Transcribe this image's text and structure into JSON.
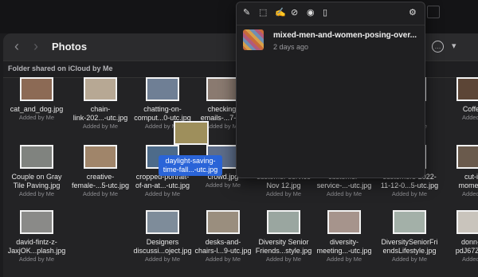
{
  "window": {
    "title": "Photos"
  },
  "share_bar": {
    "text": "Folder shared on iCloud by Me"
  },
  "files": [
    {
      "name_lines": [
        "cat_and_dog.jpg"
      ],
      "added": "Added by Me",
      "color": "#8c6a55"
    },
    {
      "name_lines": [
        "chain-",
        "link-202...-utc.jpg"
      ],
      "added": "Added by Me",
      "color": "#b7a894"
    },
    {
      "name_lines": [
        "chatting-on-",
        "comput...0-utc.jpg"
      ],
      "added": "Added by Me",
      "color": "#6f7f95"
    },
    {
      "name_lines": [
        "checking-",
        "emails-...7-utc"
      ],
      "added": "Added by Me",
      "color": "#8a7a70"
    },
    {
      "name_lines": [
        ""
      ],
      "added": "",
      "color": "#2a2a2c"
    },
    {
      "name_lines": [
        ""
      ],
      "added": "",
      "color": "#2a2a2c"
    },
    {
      "name_lines": [
        "ice",
        "...-utc.jpg"
      ],
      "added": "Added by Me",
      "color": "#7b8a93"
    },
    {
      "name_lines": [
        "Coffee"
      ],
      "added": "Added b",
      "color": "#5c4536"
    },
    {
      "name_lines": [
        "Couple on Gray",
        "Tile Paving.jpg"
      ],
      "added": "Added by Me",
      "color": "#80837f"
    },
    {
      "name_lines": [
        "creative-",
        "female-...5-utc.jpg"
      ],
      "added": "Added by Me",
      "color": "#a0856a"
    },
    {
      "name_lines": [
        "cropped-portrait-",
        "of-an-at...-utc.jpg"
      ],
      "added": "Added by Me",
      "color": "#4d6b8a"
    },
    {
      "name_lines": [
        "crowd.jpg"
      ],
      "added": "Added by Me",
      "color": "#5d6d8a"
    },
    {
      "name_lines": [
        "customer service",
        "Nov 12.jpg"
      ],
      "added": "Added by Me",
      "color": "#3f6fb0"
    },
    {
      "name_lines": [
        "customer-",
        "service-...-utc.jpg"
      ],
      "added": "Added by Me",
      "color": "#4a7fbd"
    },
    {
      "name_lines": [
        "customers-2022-",
        "11-12-0...5-utc.jpg"
      ],
      "added": "Added by Me",
      "color": "#3b88c4"
    },
    {
      "name_lines": [
        "cut-in",
        "moment.j"
      ],
      "added": "Added b",
      "color": "#6a5a4c"
    },
    {
      "name_lines": [
        "david-fintz-z-",
        "JaxjOK...plash.jpg"
      ],
      "added": "Added by Me",
      "color": "#8a8a88"
    },
    {
      "name_lines": [
        ""
      ],
      "added": "",
      "color": "#2a2a2c"
    },
    {
      "name_lines": [
        "Designers",
        "discussi...oject.jpg"
      ],
      "added": "Added by Me",
      "color": "#7e8c9a"
    },
    {
      "name_lines": [
        "desks-and-",
        "chairs-l...9-utc.jpg"
      ],
      "added": "Added by Me",
      "color": "#9a8e7e"
    },
    {
      "name_lines": [
        "Diversity Senior",
        "Friends...style.jpg"
      ],
      "added": "Added by Me",
      "color": "#9aa6a0"
    },
    {
      "name_lines": [
        "diversity-",
        "meeting...-utc.jpg"
      ],
      "added": "Added by Me",
      "color": "#a6948c"
    },
    {
      "name_lines": [
        "DiversitySeniorFri",
        "endsLifestyle.jpg"
      ],
      "added": "Added by Me",
      "color": "#a3b0a8"
    },
    {
      "name_lines": [
        "donn-st",
        "pdJ67Z...pl"
      ],
      "added": "Added b",
      "color": "#c9c4bc"
    }
  ],
  "drag": {
    "label_lines": [
      "daylight-saving-",
      "time-fall...-utc.jpg"
    ]
  },
  "clipboard": {
    "item_name": "mixed-men-and-women-posing-over...",
    "item_time": "2 days ago"
  }
}
